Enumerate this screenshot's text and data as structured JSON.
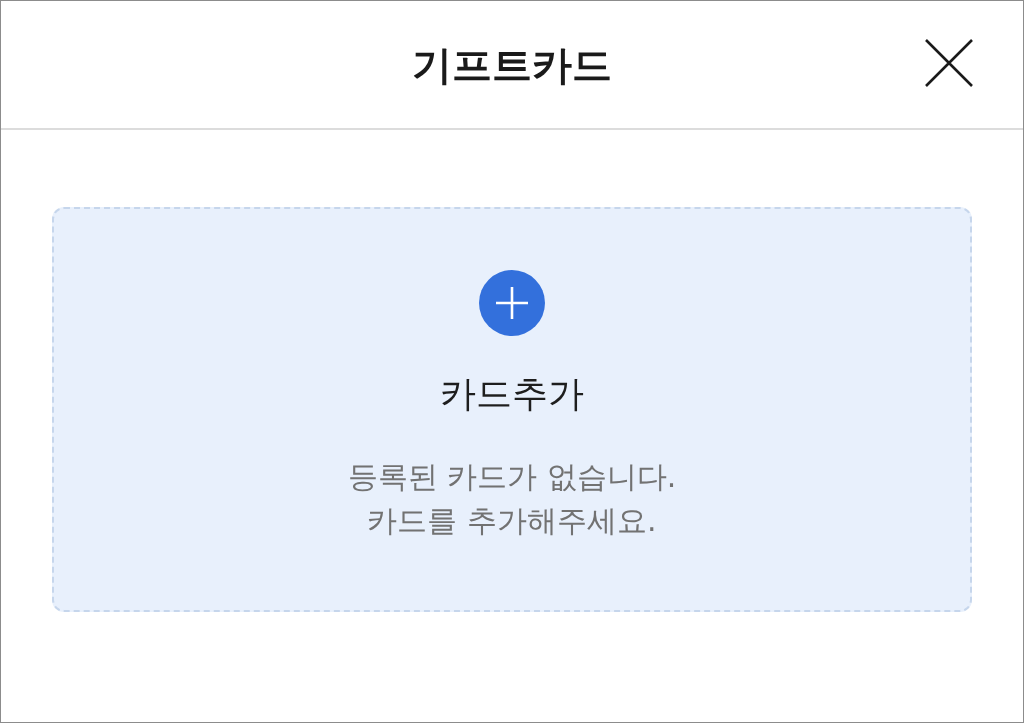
{
  "header": {
    "title": "기프트카드"
  },
  "empty_card": {
    "action_label": "카드추가",
    "message_lines": [
      "등록된 카드가 없습니다.",
      "카드를 추가해주세요."
    ]
  }
}
